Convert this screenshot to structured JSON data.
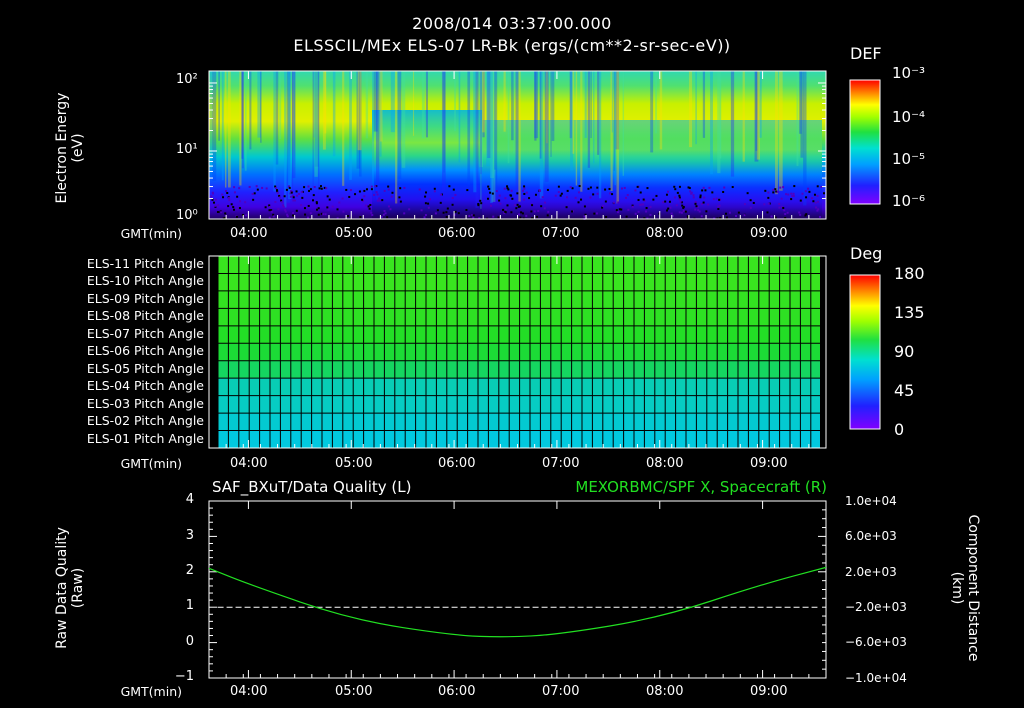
{
  "header": {
    "datetime": "2008/014 03:37:00.000",
    "subtitle": "ELSSCIL/MEx ELS-07 LR-Bk  (ergs/(cm**2-sr-sec-eV))"
  },
  "panel1": {
    "ylabel_line1": "Electron Energy",
    "ylabel_line2": "(eV)",
    "yticks": [
      "10²",
      "10¹",
      "10⁰"
    ],
    "xlabel": "GMT(min)",
    "colorbar_title": "DEF",
    "colorbar_ticks": [
      "10⁻³",
      "10⁻⁴",
      "10⁻⁵",
      "10⁻⁶"
    ]
  },
  "panel2": {
    "row_labels": [
      "ELS-11 Pitch Angle",
      "ELS-10 Pitch Angle",
      "ELS-09 Pitch Angle",
      "ELS-08 Pitch Angle",
      "ELS-07 Pitch Angle",
      "ELS-06 Pitch Angle",
      "ELS-05 Pitch Angle",
      "ELS-04 Pitch Angle",
      "ELS-03 Pitch Angle",
      "ELS-02 Pitch Angle",
      "ELS-01 Pitch Angle"
    ],
    "xlabel": "GMT(min)",
    "colorbar_title": "Deg",
    "colorbar_ticks": [
      "180",
      "135",
      "90",
      "45",
      "0"
    ]
  },
  "panel3": {
    "left_title": "SAF_BXuT/Data Quality (L)",
    "right_title": "MEXORBMC/SPF X, Spacecraft (R)",
    "ylabel_left_1": "Raw Data Quality",
    "ylabel_left_2": "(Raw)",
    "ylabel_right_1": "Component Distance",
    "ylabel_right_2": "(km)",
    "left_ticks": [
      "4",
      "3",
      "2",
      "1",
      "0",
      "−1"
    ],
    "right_ticks": [
      "1.0e+04",
      "6.0e+03",
      "2.0e+03",
      "−2.0e+03",
      "−6.0e+03",
      "−1.0e+04"
    ],
    "xlabel": "GMT(min)"
  },
  "time_ticks": [
    "04:00",
    "05:00",
    "06:00",
    "07:00",
    "08:00",
    "09:00"
  ],
  "chart_data": [
    {
      "type": "heatmap",
      "title": "ELSSCIL/MEx ELS-07 LR-Bk",
      "xlabel": "GMT(min)",
      "ylabel": "Electron Energy (eV)",
      "y_scale": "log",
      "ylim": [
        1,
        150
      ],
      "xlim": [
        "03:37",
        "09:37"
      ],
      "color_scale": "log",
      "color_range": [
        1e-06,
        0.001
      ],
      "colorbar_label": "DEF"
    },
    {
      "type": "heatmap",
      "xlabel": "GMT(min)",
      "categories": [
        "ELS-11",
        "ELS-10",
        "ELS-09",
        "ELS-08",
        "ELS-07",
        "ELS-06",
        "ELS-05",
        "ELS-04",
        "ELS-03",
        "ELS-02",
        "ELS-01"
      ],
      "values_deg": [
        100,
        100,
        98,
        96,
        92,
        88,
        82,
        70,
        68,
        66,
        64
      ],
      "color_range": [
        0,
        180
      ],
      "colorbar_label": "Deg"
    },
    {
      "type": "line",
      "xlabel": "GMT(min)",
      "left_axis": {
        "ylim": [
          -1,
          4
        ],
        "label": "Raw Data Quality (Raw)"
      },
      "right_axis": {
        "ylim": [
          -10000,
          10000
        ],
        "label": "Component Distance (km)"
      },
      "series": [
        {
          "name": "SAF_BXuT/Data Quality (L)",
          "axis": "left",
          "color": "#ffffff",
          "x": [
            "03:42",
            "09:32"
          ],
          "y": [
            1,
            1
          ]
        },
        {
          "name": "MEXORBMC/SPF X, Spacecraft (R)",
          "axis": "right",
          "color": "#22e022",
          "x": [
            "03:37",
            "04:00",
            "05:00",
            "06:00",
            "06:30",
            "07:00",
            "08:00",
            "09:00",
            "09:37"
          ],
          "y": [
            2400,
            600,
            -3400,
            -5200,
            -5400,
            -5100,
            -3200,
            600,
            2500
          ]
        }
      ]
    }
  ]
}
